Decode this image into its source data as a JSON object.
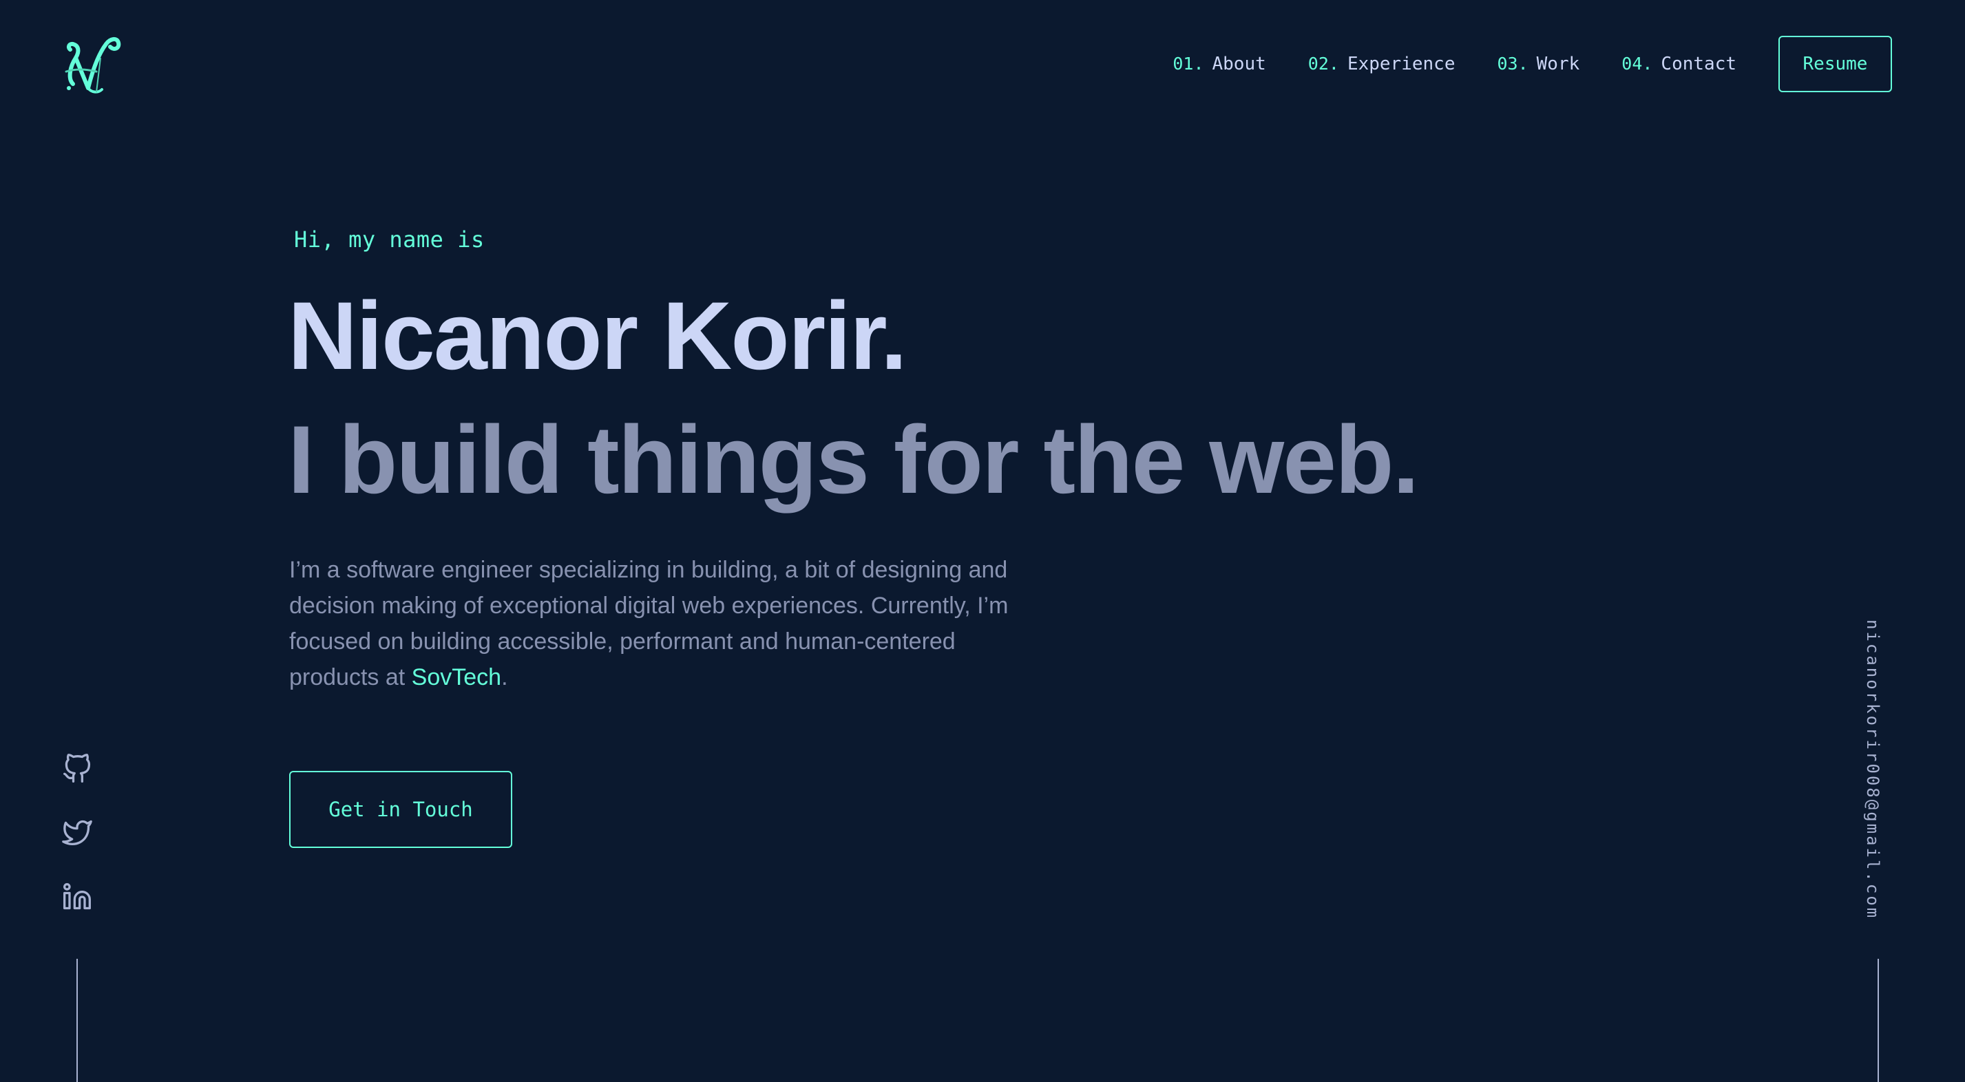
{
  "logo": {
    "letter": "N"
  },
  "nav": {
    "items": [
      {
        "num": "01.",
        "label": "About"
      },
      {
        "num": "02.",
        "label": "Experience"
      },
      {
        "num": "03.",
        "label": "Work"
      },
      {
        "num": "04.",
        "label": "Contact"
      }
    ],
    "resume_label": "Resume"
  },
  "hero": {
    "greeting": "Hi, my name is",
    "name": "Nicanor Korir.",
    "tagline": "I build things for the web.",
    "bio_text": "I’m a software engineer specializing in building, a bit of designing and decision making of exceptional digital web experiences. Currently, I’m focused on building accessible, performant and human-centered products at ",
    "bio_link": "SovTech",
    "bio_end": ".",
    "cta_label": "Get in Touch"
  },
  "social": {
    "icons": [
      "github-icon",
      "twitter-icon",
      "linkedin-icon"
    ]
  },
  "email": "nicanorkorir008@gmail.com",
  "colors": {
    "background": "#0b192f",
    "accent": "#64ffda",
    "heading": "#ccd6f6",
    "text": "#8892b0",
    "light": "#a8b2d1"
  }
}
